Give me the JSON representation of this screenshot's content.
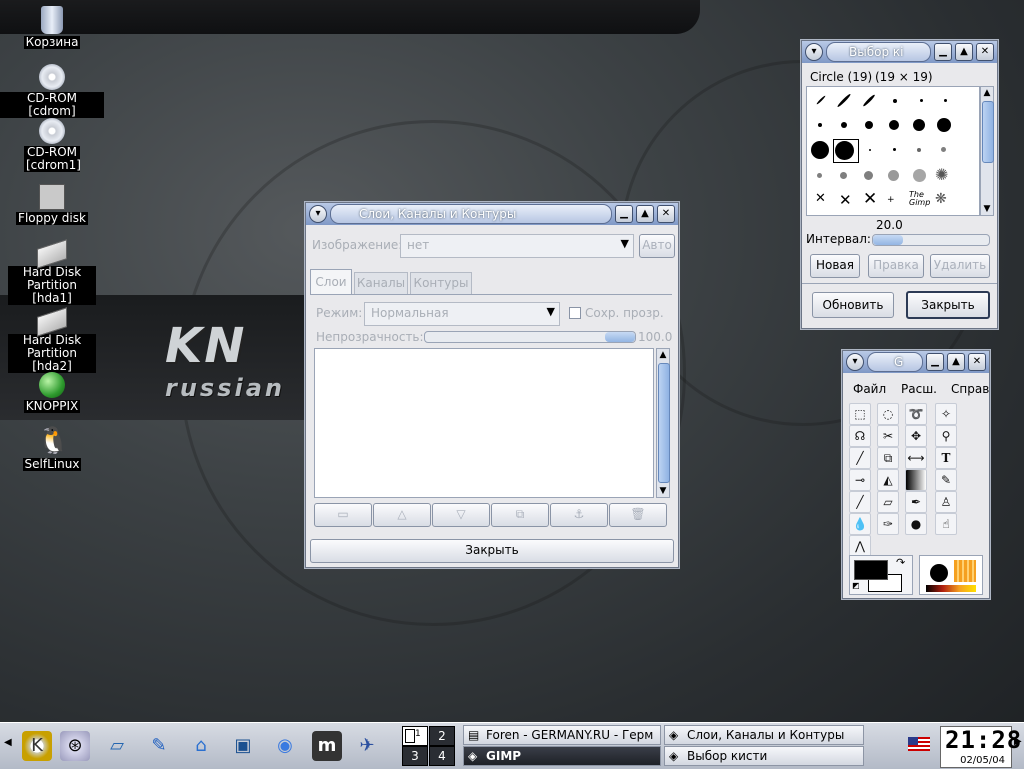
{
  "desktop": {
    "icons": [
      {
        "label": "Корзина",
        "icon": "trash-icon"
      },
      {
        "label": "CD-ROM [cdrom]",
        "icon": "cdrom-icon"
      },
      {
        "label": "CD-ROM [cdrom1]",
        "icon": "cdrom-icon"
      },
      {
        "label": "Floppy disk",
        "icon": "floppy-icon"
      },
      {
        "label": "Hard Disk Partition [hda1]",
        "icon": "harddisk-icon"
      },
      {
        "label": "Hard Disk Partition [hda2]",
        "icon": "harddisk-icon"
      },
      {
        "label": "KNOPPIX",
        "icon": "globe-icon"
      },
      {
        "label": "SelfLinux",
        "icon": "tux-icon"
      }
    ],
    "logo_text": "KN",
    "logo_sub": "russian"
  },
  "layers": {
    "title": "Слои, Каналы и Контуры",
    "image_label": "Изображение:",
    "image_value": "нет",
    "auto_btn": "Авто",
    "tabs": [
      "Слои",
      "Каналы",
      "Контуры"
    ],
    "mode_label": "Режим:",
    "mode_value": "Нормальная",
    "keep_trans": "Сохр. прозр.",
    "opacity_label": "Непрозрачность:",
    "opacity_value": "100.0",
    "close_btn": "Закрыть"
  },
  "brushes": {
    "title": "Выбор кі",
    "selected": "Circle (19)",
    "size": "(19 × 19)",
    "spacing_value": "20.0",
    "spacing_label": "Интервал:",
    "new_btn": "Новая",
    "edit_btn": "Правка",
    "delete_btn": "Удалить",
    "refresh_btn": "Обновить",
    "close_btn": "Закрыть"
  },
  "toolbox": {
    "title": "G",
    "menu": [
      "Файл",
      "Расш.",
      "Справ"
    ]
  },
  "taskbar": {
    "pager": [
      "1",
      "2",
      "3",
      "4"
    ],
    "tasks": [
      "Foren - GERMANY.RU - Герм",
      "GIMP",
      "Слои, Каналы и Контуры",
      "Выбор кисти"
    ],
    "clock": "21:28",
    "date": "02/05/04"
  },
  "colors": {
    "accent": "#7f98c6",
    "fg_color": "#000000",
    "bg_color": "#ffffff",
    "gradient_end": "#f5a020"
  }
}
